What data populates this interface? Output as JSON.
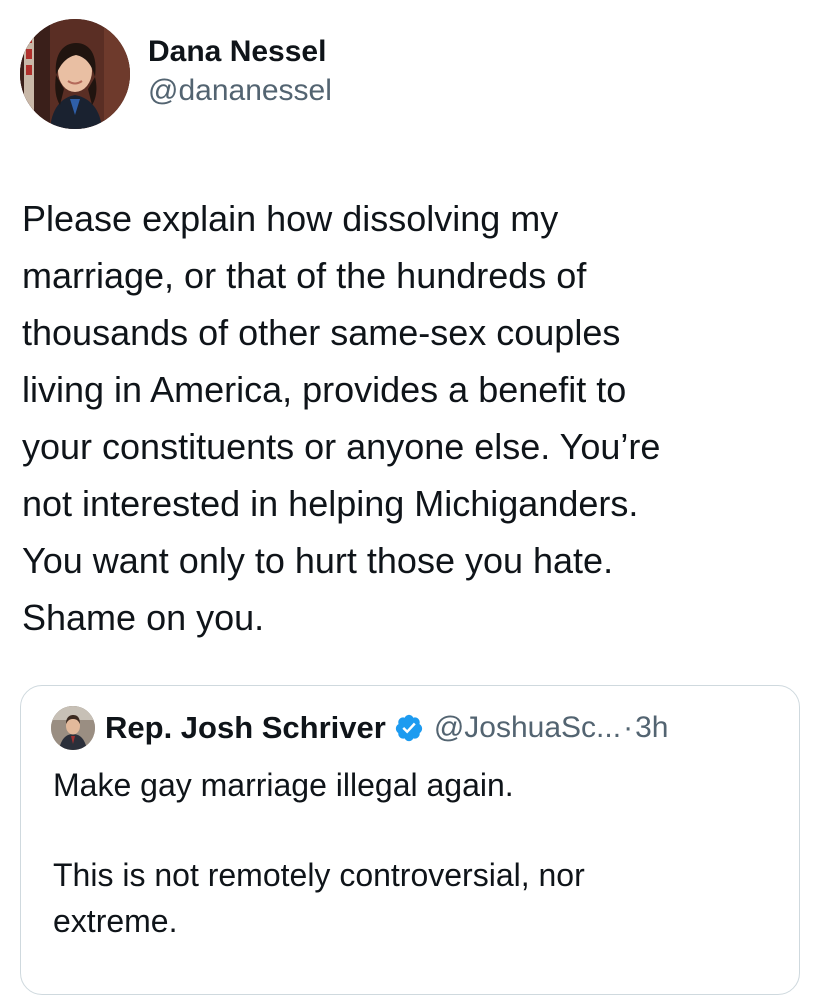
{
  "author": {
    "display_name": "Dana Nessel",
    "handle": "@dananessel",
    "avatar_icon": "profile-photo"
  },
  "tweet": {
    "lines": [
      "Please explain how dissolving my",
      "marriage, or that of the hundreds of",
      "thousands of other same-sex couples",
      "living in America, provides a benefit to",
      "your constituents or anyone else. You’re",
      "not interested in helping Michiganders.",
      "You want only to hurt those you hate.",
      "Shame on you."
    ]
  },
  "quoted_tweet": {
    "display_name": "Rep. Josh Schriver",
    "verified_icon": "verified-badge-icon",
    "verified_color": "#1d9bf0",
    "handle": "@JoshuaSc...",
    "separator": "·",
    "time": "3h",
    "paragraph_1": "Make gay marriage illegal again.",
    "paragraph_2_lines": [
      "This is not remotely controversial, nor",
      "extreme."
    ]
  },
  "colors": {
    "text_primary": "#0f1419",
    "text_secondary": "#536471",
    "border": "#cfd9de"
  }
}
